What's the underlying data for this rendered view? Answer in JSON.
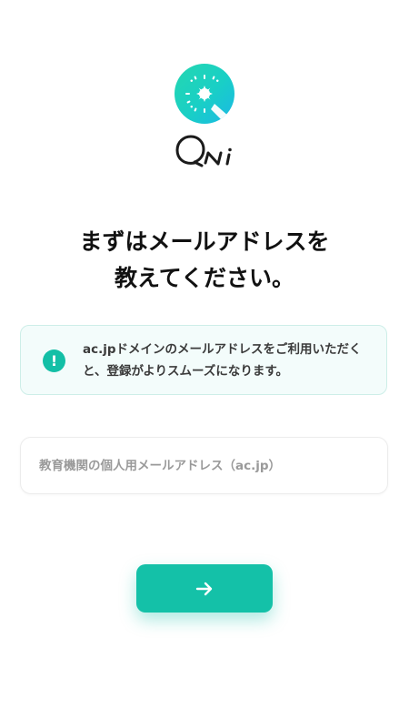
{
  "brand": {
    "logo_icon": "sparkle-badge-icon",
    "wordmark": "Qni",
    "colors": {
      "accent": "#14c1a8",
      "gradient_start": "#25d7b0",
      "gradient_end": "#1ab8e6"
    }
  },
  "heading": {
    "line1": "まずはメールアドレスを",
    "line2": "教えてください。"
  },
  "notice": {
    "icon": "exclamation-circle-icon",
    "text": "ac.jpドメインのメールアドレスをご利用いただくと、登録がよりスムーズになります。"
  },
  "email_input": {
    "value": "",
    "placeholder": "教育機関の個人用メールアドレス（ac.jp）"
  },
  "next_button": {
    "icon": "arrow-right-icon"
  }
}
